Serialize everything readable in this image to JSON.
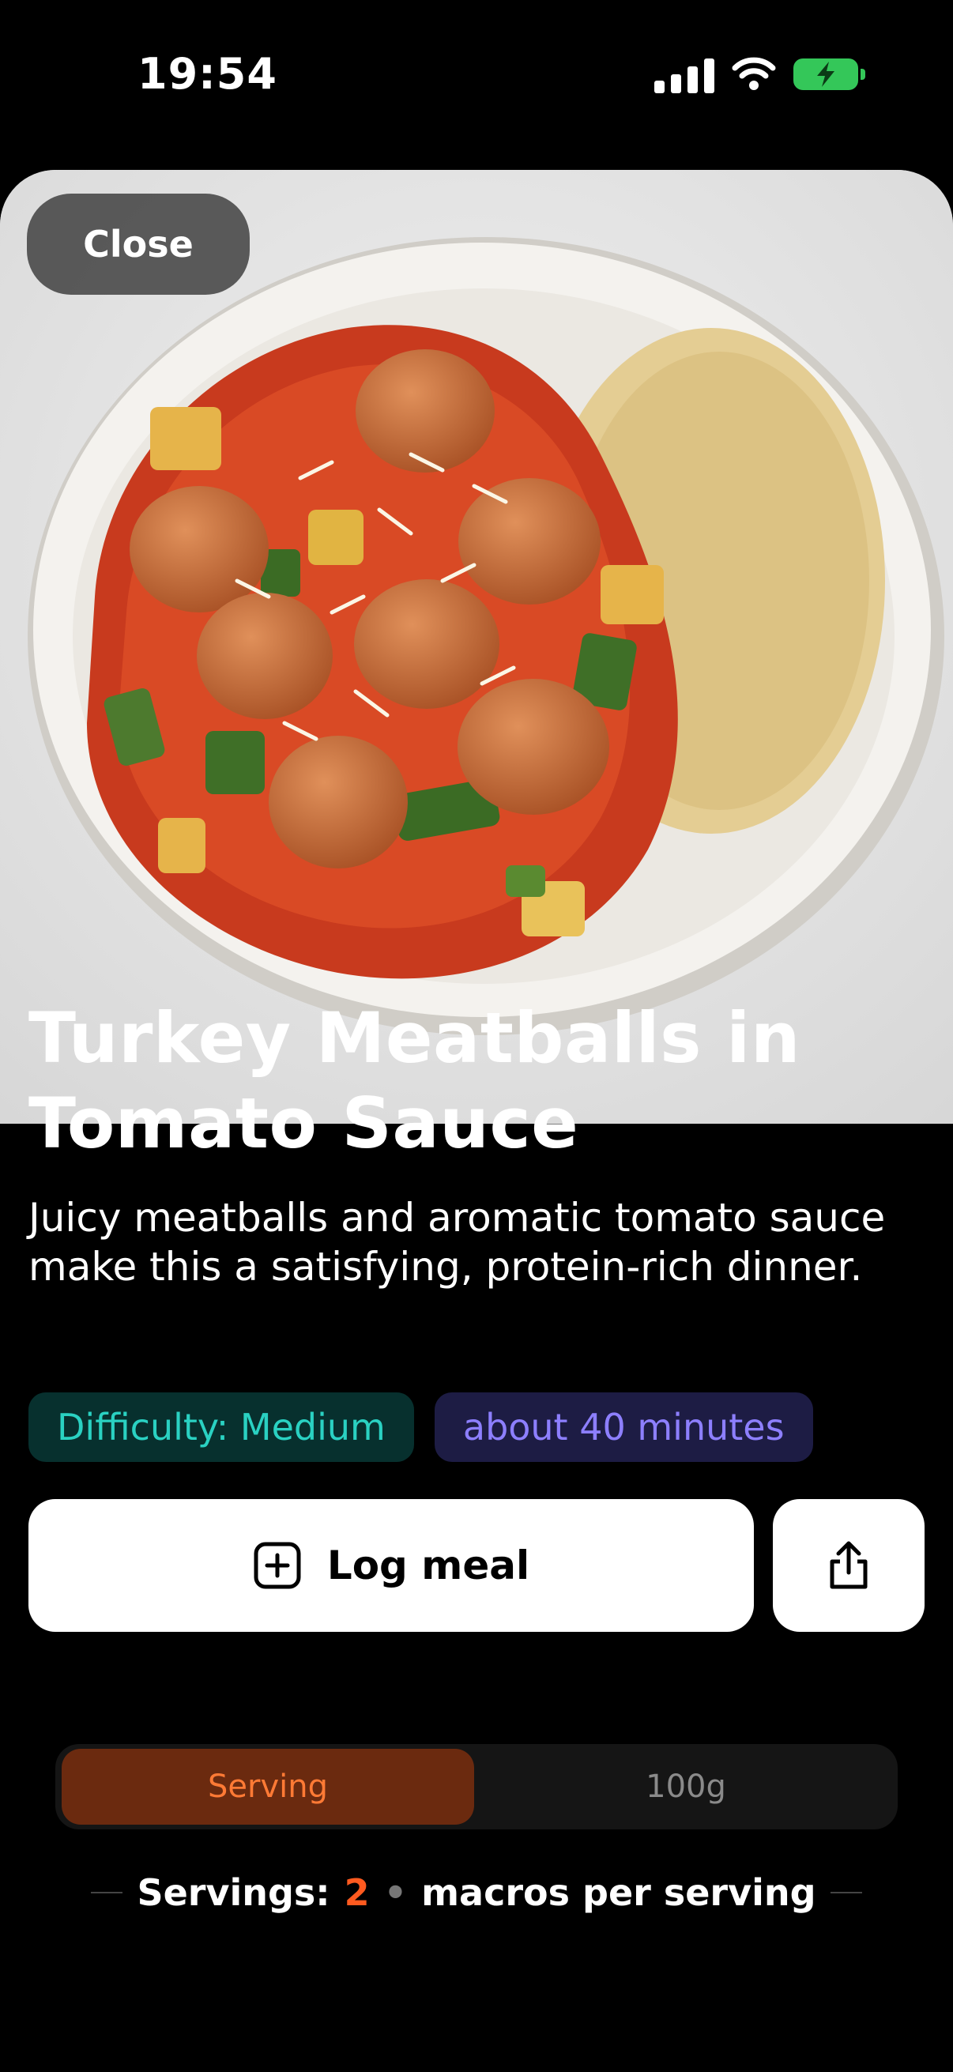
{
  "status_bar": {
    "time": "19:54",
    "icons": [
      "cellular-signal-icon",
      "wifi-icon",
      "battery-charging-icon"
    ]
  },
  "hero": {
    "image": "plate of turkey meatballs in tomato sauce with zucchini and couscous",
    "close_label": "Close"
  },
  "recipe": {
    "title": "Turkey Meatballs in Tomato Sauce",
    "description": "Juicy meatballs and aromatic tomato sauce make this a satisfying, protein-rich dinner.",
    "tags": {
      "difficulty": "Difficulty: Medium",
      "time": "about 40 minutes"
    }
  },
  "actions": {
    "log_meal_label": "Log meal",
    "log_meal_icon": "plus-square-icon",
    "share_icon": "share-icon"
  },
  "nutrition": {
    "segments": [
      "Serving",
      "100g"
    ],
    "selected": "Serving",
    "servings_label": "Servings:",
    "servings_count": "2",
    "servings_suffix": "macros per serving"
  },
  "colors": {
    "background": "#000000",
    "accent_orange": "#ff5a1f",
    "difficulty_tag": "#2ad1c2",
    "time_tag": "#8d7fff",
    "battery": "#34c759"
  }
}
